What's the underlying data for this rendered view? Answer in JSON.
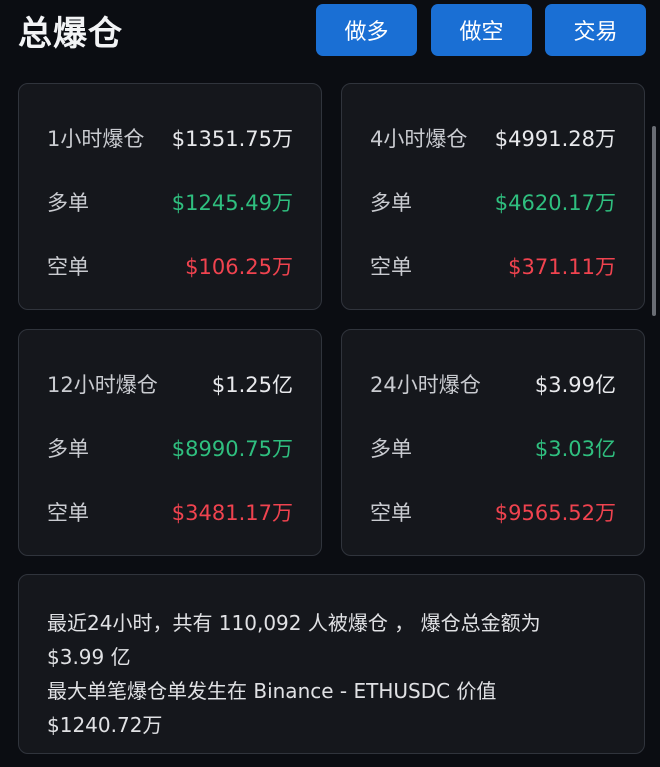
{
  "header": {
    "title": "总爆仓",
    "buttons": {
      "long": "做多",
      "short": "做空",
      "trade": "交易"
    }
  },
  "cards": [
    {
      "period_label": "1小时爆仓",
      "total": "$1351.75万",
      "long_label": "多单",
      "long_value": "$1245.49万",
      "short_label": "空单",
      "short_value": "$106.25万"
    },
    {
      "period_label": "4小时爆仓",
      "total": "$4991.28万",
      "long_label": "多单",
      "long_value": "$4620.17万",
      "short_label": "空单",
      "short_value": "$371.11万"
    },
    {
      "period_label": "12小时爆仓",
      "total": "$1.25亿",
      "long_label": "多单",
      "long_value": "$8990.75万",
      "short_label": "空单",
      "short_value": "$3481.17万"
    },
    {
      "period_label": "24小时爆仓",
      "total": "$3.99亿",
      "long_label": "多单",
      "long_value": "$3.03亿",
      "short_label": "空单",
      "short_value": "$9565.52万"
    }
  ],
  "summary": {
    "line1": "最近24小时，共有 110,092 人被爆仓 ， 爆仓总金额为",
    "line2": "$3.99 亿",
    "line3": "最大单笔爆仓单发生在 Binance - ETHUSDC 价值",
    "line4": "$1240.72万"
  },
  "colors": {
    "accent": "#1a6fd4",
    "long": "#2fbf7f",
    "short": "#f0434f",
    "background": "#0b0d12",
    "card": "#15171c"
  }
}
